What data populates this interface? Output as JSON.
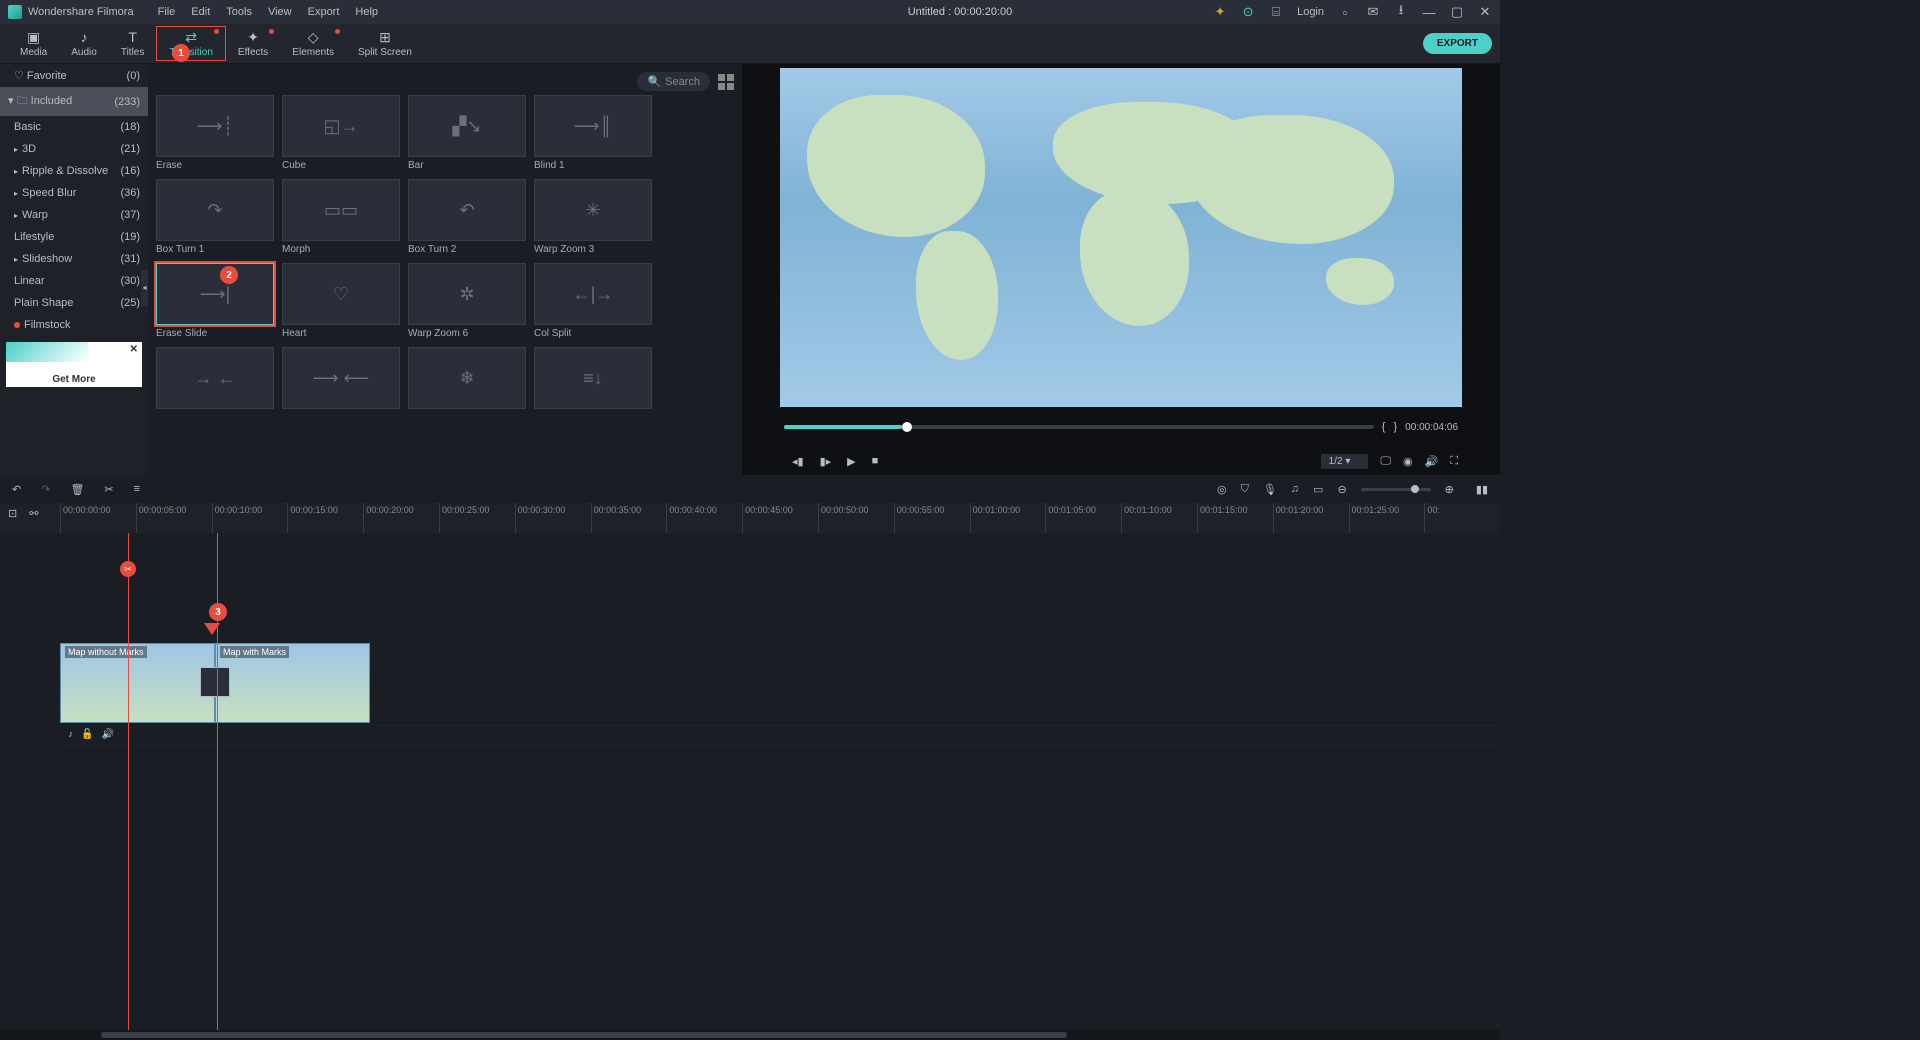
{
  "app_name": "Wondershare Filmora",
  "menu": [
    "File",
    "Edit",
    "Tools",
    "View",
    "Export",
    "Help"
  ],
  "title": "Untitled : 00:00:20:00",
  "login": "Login",
  "toolbar": {
    "tabs": [
      {
        "label": "Media"
      },
      {
        "label": "Audio"
      },
      {
        "label": "Titles"
      },
      {
        "label": "Transition",
        "active": true,
        "dot": true
      },
      {
        "label": "Effects",
        "dot": true
      },
      {
        "label": "Elements",
        "dot": true
      },
      {
        "label": "Split Screen"
      }
    ],
    "export": "EXPORT"
  },
  "sidebar": {
    "favorite": {
      "label": "Favorite",
      "count": "(0)"
    },
    "included": {
      "label": "Included",
      "count": "(233)"
    },
    "items": [
      {
        "label": "Basic",
        "count": "(18)"
      },
      {
        "label": "3D",
        "count": "(21)",
        "chev": true
      },
      {
        "label": "Ripple & Dissolve",
        "count": "(16)",
        "chev": true
      },
      {
        "label": "Speed Blur",
        "count": "(36)",
        "chev": true
      },
      {
        "label": "Warp",
        "count": "(37)",
        "chev": true
      },
      {
        "label": "Lifestyle",
        "count": "(19)"
      },
      {
        "label": "Slideshow",
        "count": "(31)",
        "chev": true
      },
      {
        "label": "Linear",
        "count": "(30)"
      },
      {
        "label": "Plain Shape",
        "count": "(25)"
      }
    ],
    "filmstock": "Filmstock",
    "getmore": "Get More"
  },
  "panel": {
    "search_placeholder": "Search",
    "items": [
      "Erase",
      "Cube",
      "Bar",
      "Blind 1",
      "Box Turn 1",
      "Morph",
      "Box Turn 2",
      "Warp Zoom 3",
      "Erase Slide",
      "Heart",
      "Warp Zoom 6",
      "Col Split",
      "",
      "",
      "",
      ""
    ]
  },
  "callouts": [
    "1",
    "2",
    "3"
  ],
  "preview": {
    "time": "00:00:04:06",
    "zoom": "1/2"
  },
  "timeline": {
    "ticks": [
      "00:00:00:00",
      "00:00:05:00",
      "00:00:10:00",
      "00:00:15:00",
      "00:00:20:00",
      "00:00:25:00",
      "00:00:30:00",
      "00:00:35:00",
      "00:00:40:00",
      "00:00:45:00",
      "00:00:50:00",
      "00:00:55:00",
      "00:01:00:00",
      "00:01:05:00",
      "00:01:10:00",
      "00:01:15:00",
      "00:01:20:00",
      "00:01:25:00",
      "00:"
    ],
    "clip1": "Map without Marks",
    "clip2": "Map with Marks",
    "video_track": "",
    "audio_track": ""
  }
}
